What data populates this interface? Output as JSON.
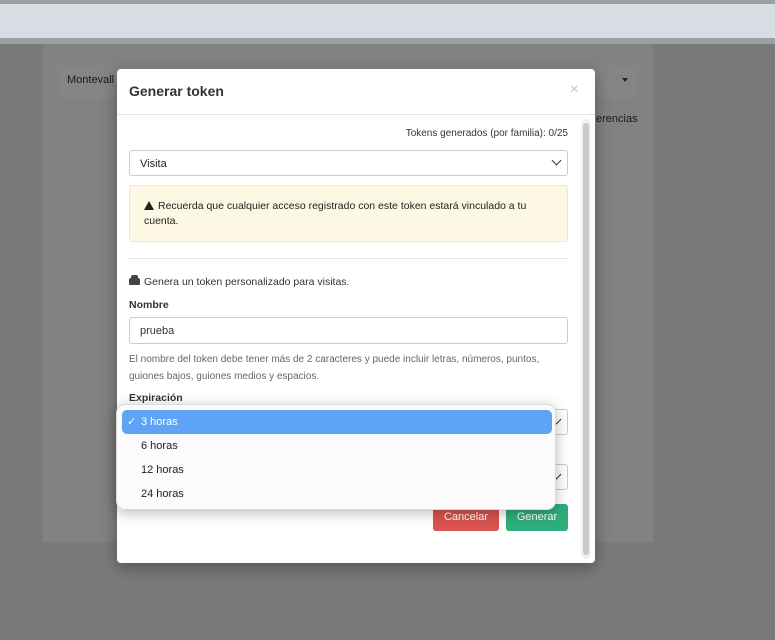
{
  "background": {
    "select_text": "Montevall",
    "right_text": "erencias"
  },
  "modal": {
    "title": "Generar token",
    "close_glyph": "×",
    "counter": "Tokens generados (por familia): 0/25",
    "type_select_value": "Visita",
    "alert_text": "Recuerda que cualquier acceso registrado con este token estará vinculado a tu cuenta.",
    "info_text": "Genera un token personalizado para visitas.",
    "name_label": "Nombre",
    "name_value": "prueba",
    "name_help": "El nombre del token debe tener más de 2 caracteres y puede incluir letras, números, puntos, guiones bajos, guiones medios y espacios.",
    "expiration_label": "Expiración",
    "cancel_label": "Cancelar",
    "generate_label": "Generar"
  },
  "dropdown": {
    "items": [
      "3 horas",
      "6 horas",
      "12 horas",
      "24 horas"
    ],
    "selected_index": 0,
    "check_glyph": "✓"
  },
  "colors": {
    "cancel": "#d9534f",
    "generate": "#2eae7a",
    "selected_option": "#5ea3f5",
    "alert_bg": "#fcf8e3"
  }
}
